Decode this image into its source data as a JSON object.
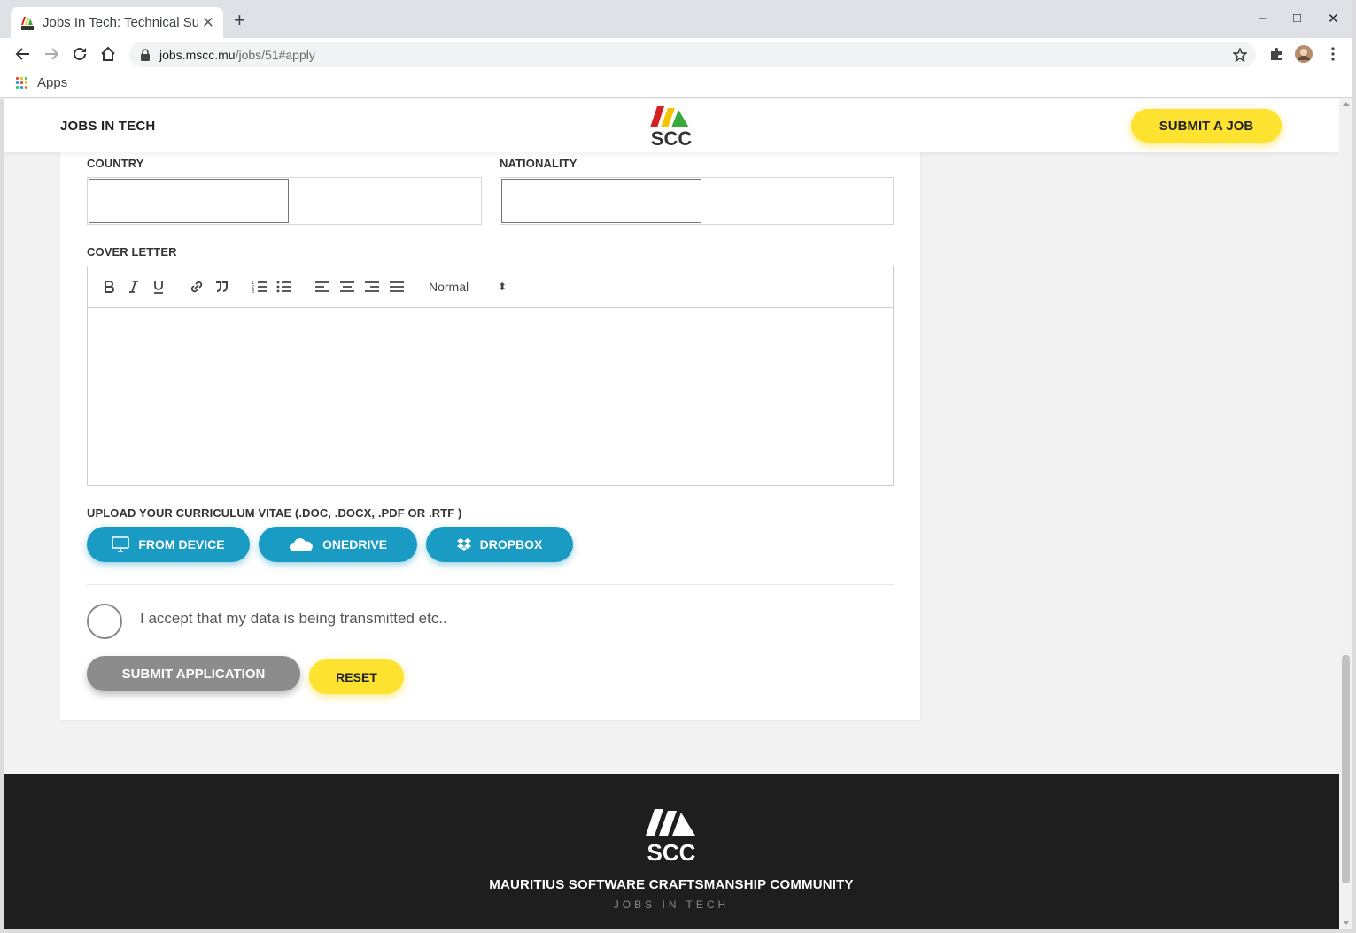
{
  "browser": {
    "tab_title": "Jobs In Tech: Technical Su",
    "tab_close": "✕",
    "new_tab": "+",
    "url_host": "jobs.mscc.mu",
    "url_path": "/jobs/51#apply",
    "bookmark_apps": "Apps",
    "window_controls": {
      "minimize": "–",
      "maximize": "□",
      "close": "✕"
    }
  },
  "header": {
    "site_name": "JOBS IN TECH",
    "logo_text": "SCC",
    "submit_job_label": "SUBMIT A JOB"
  },
  "form": {
    "country_label": "COUNTRY",
    "nationality_label": "NATIONALITY",
    "cover_letter_label": "COVER LETTER",
    "editor_format": "Normal",
    "editor_format_arrows": "⬍",
    "upload_label": "UPLOAD YOUR CURRICULUM VITAE (.DOC, .DOCX, .PDF OR .RTF )",
    "upload_buttons": {
      "device": "FROM DEVICE",
      "onedrive": "ONEDRIVE",
      "dropbox": "DROPBOX"
    },
    "accept_text": "I accept that my data is being transmitted etc..",
    "submit_label": "SUBMIT APPLICATION",
    "reset_label": "RESET"
  },
  "footer": {
    "logo_text": "SCC",
    "title": "MAURITIUS SOFTWARE CRAFTSMANSHIP COMMUNITY",
    "subtitle": "JOBS IN TECH"
  },
  "colors": {
    "accent_yellow": "#fde22f",
    "accent_blue": "#1a9bc4",
    "submit_gray": "#8c8c8c",
    "footer_bg": "#1e1e1e"
  },
  "icons": {
    "bold": "bold-icon",
    "italic": "italic-icon",
    "underline": "underline-icon",
    "link": "link-icon",
    "quote": "quote-icon",
    "ordered_list": "ordered-list-icon",
    "bullet_list": "bullet-list-icon",
    "align_left": "align-left-icon",
    "align_center": "align-center-icon",
    "align_right": "align-right-icon",
    "align_justify": "align-justify-icon",
    "device": "monitor-icon",
    "onedrive": "cloud-icon",
    "dropbox": "dropbox-icon"
  }
}
